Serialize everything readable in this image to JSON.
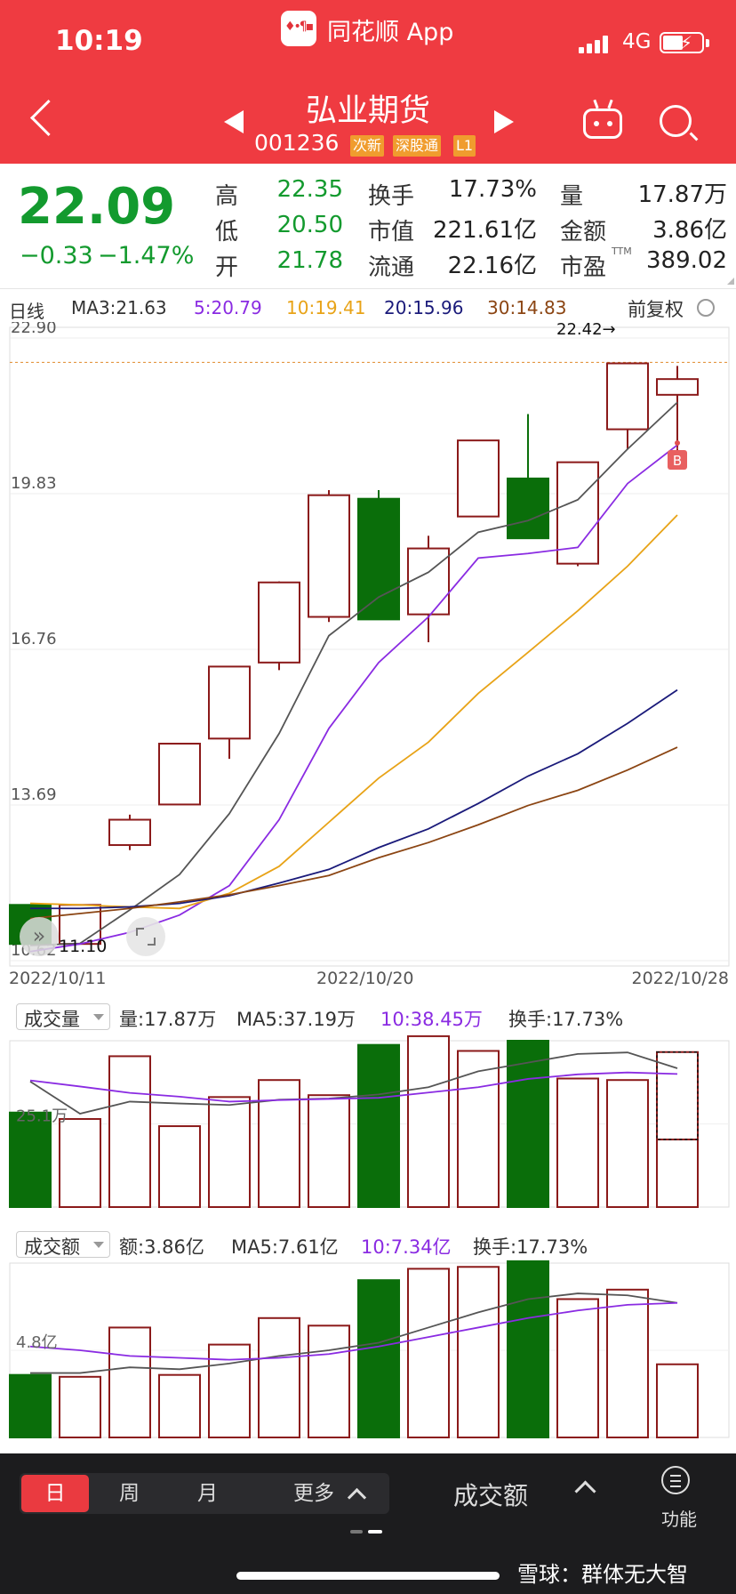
{
  "status_bar": {
    "time": "10:19",
    "network": "4G"
  },
  "app": {
    "name": "同花顺 App",
    "icon_text": "♦•¶▪"
  },
  "stock": {
    "name": "弘业期货",
    "code": "001236",
    "tags": [
      "次新",
      "深股通",
      "L1"
    ]
  },
  "quote": {
    "price": "22.09",
    "change": "−0.33",
    "change_pct": "−1.47%",
    "rows": [
      {
        "l1": "高",
        "v1": "22.35",
        "l2": "换手",
        "v2": "17.73%",
        "l3": "量",
        "v3": "17.87万"
      },
      {
        "l1": "低",
        "v1": "20.50",
        "l2": "市值",
        "v2": "221.61亿",
        "l3": "金额",
        "v3": "3.86亿"
      },
      {
        "l1": "开",
        "v1": "21.78",
        "l2": "流通",
        "v2": "22.16亿",
        "l3": "市盈",
        "v3": "389.02"
      }
    ],
    "ttm": "TTM"
  },
  "kline_header": {
    "period": "日线",
    "ma3": "MA3:21.63",
    "ma5": "5:20.79",
    "ma10": "10:19.41",
    "ma20": "20:15.96",
    "ma30": "30:14.83",
    "adjust": "前复权"
  },
  "colors": {
    "up": "#8b1a1a",
    "down": "#0a6e0a",
    "ma3": "#555555",
    "ma5": "#8a2be2",
    "ma10": "#e8a317",
    "ma20": "#1a1a7a",
    "ma30": "#8b4513"
  },
  "chart_data": [
    {
      "type": "candlestick",
      "yticks": [
        "22.90",
        "19.83",
        "16.76",
        "13.69",
        "10.62"
      ],
      "ylim": [
        10.62,
        22.9
      ],
      "xticks": [
        "2022/10/11",
        "2022/10/20",
        "2022/10/28"
      ],
      "annotations": {
        "high_label": "22.42→",
        "low_label": "11.10",
        "signal": "B"
      },
      "candles": [
        {
          "o": 11.72,
          "h": 11.72,
          "l": 10.95,
          "c": 10.95
        },
        {
          "o": 10.95,
          "h": 11.72,
          "l": 10.95,
          "c": 11.72
        },
        {
          "o": 12.9,
          "h": 13.5,
          "l": 12.8,
          "c": 13.4
        },
        {
          "o": 13.7,
          "h": 14.85,
          "l": 13.7,
          "c": 14.9
        },
        {
          "o": 15.0,
          "h": 16.4,
          "l": 14.6,
          "c": 16.42
        },
        {
          "o": 16.5,
          "h": 18.1,
          "l": 16.35,
          "c": 18.08
        },
        {
          "o": 17.4,
          "h": 19.9,
          "l": 17.3,
          "c": 19.8
        },
        {
          "o": 19.73,
          "h": 19.9,
          "l": 17.45,
          "c": 17.35
        },
        {
          "o": 17.45,
          "h": 19.0,
          "l": 16.9,
          "c": 18.75
        },
        {
          "o": 19.38,
          "h": 20.88,
          "l": 19.38,
          "c": 20.88
        },
        {
          "o": 20.13,
          "h": 21.4,
          "l": 18.95,
          "c": 18.95
        },
        {
          "o": 18.45,
          "h": 20.45,
          "l": 18.4,
          "c": 20.45
        },
        {
          "o": 21.1,
          "h": 22.42,
          "l": 20.7,
          "c": 22.4
        },
        {
          "o": 21.78,
          "h": 22.35,
          "l": 20.5,
          "c": 22.09
        }
      ],
      "ma3": [
        10.92,
        10.96,
        11.62,
        12.32,
        13.52,
        15.1,
        17.03,
        17.79,
        18.28,
        19.07,
        19.3,
        19.71,
        20.71,
        21.63
      ],
      "ma5": [
        10.8,
        10.95,
        11.18,
        11.52,
        12.1,
        13.4,
        15.2,
        16.5,
        17.4,
        18.56,
        18.65,
        18.77,
        20.03,
        20.79
      ],
      "ma10": [
        11.75,
        11.72,
        11.68,
        11.65,
        11.95,
        12.48,
        13.35,
        14.22,
        14.93,
        15.89,
        16.7,
        17.52,
        18.4,
        19.41
      ],
      "ma20": [
        11.65,
        11.65,
        11.68,
        11.75,
        11.9,
        12.15,
        12.42,
        12.85,
        13.22,
        13.72,
        14.26,
        14.7,
        15.3,
        15.96
      ],
      "ma30": [
        11.45,
        11.55,
        11.65,
        11.78,
        11.92,
        12.1,
        12.3,
        12.65,
        12.95,
        13.3,
        13.68,
        13.98,
        14.38,
        14.83
      ]
    },
    {
      "type": "bar",
      "label": "成交量",
      "info": {
        "vol": "量:17.87万",
        "ma5": "MA5:37.19万",
        "ma10": "10:38.45万",
        "turnover": "换手:17.73%"
      },
      "ytick": "25.1万",
      "ylim": [
        0,
        44
      ],
      "values": [
        25,
        23.3,
        39.9,
        21.4,
        29.1,
        33.6,
        29.6,
        42.9,
        45.2,
        41.3,
        44.0,
        34.0,
        33.6,
        41.0
      ],
      "current_value": 17.87,
      "ma_a": [
        33.2,
        24.7,
        27.9,
        27.4,
        27.0,
        28.4,
        28.7,
        29.8,
        31.7,
        35.9,
        38.2,
        40.5,
        40.9,
        36.7
      ],
      "ma_b": [
        33.5,
        31.9,
        30.2,
        29.2,
        27.9,
        28.3,
        28.6,
        28.9,
        30.3,
        31.7,
        33.9,
        35.1,
        35.6,
        35.2
      ]
    },
    {
      "type": "bar",
      "label": "成交额",
      "info": {
        "amount": "额:3.86亿",
        "ma5": "MA5:7.61亿",
        "ma10": "10:7.34亿",
        "turnover": "换手:17.73%"
      },
      "ytick": "4.8亿",
      "ylim": [
        0,
        9.2
      ],
      "values": [
        3.3,
        3.2,
        5.8,
        3.3,
        4.9,
        6.3,
        5.9,
        8.3,
        8.9,
        9.0,
        9.3,
        7.3,
        7.8,
        3.86
      ],
      "ma_a": [
        3.4,
        3.4,
        3.7,
        3.6,
        3.9,
        4.3,
        4.6,
        5.0,
        5.8,
        6.6,
        7.3,
        7.6,
        7.5,
        7.1
      ],
      "ma_b": [
        4.8,
        4.6,
        4.3,
        4.2,
        4.1,
        4.2,
        4.4,
        4.8,
        5.3,
        5.8,
        6.3,
        6.7,
        7.0,
        7.1
      ]
    }
  ],
  "bottom_nav": {
    "tabs": [
      "日",
      "周",
      "月"
    ],
    "more": "更多",
    "indicator": "成交额",
    "function": "功能"
  },
  "watermark": "雪球：群体无大智"
}
